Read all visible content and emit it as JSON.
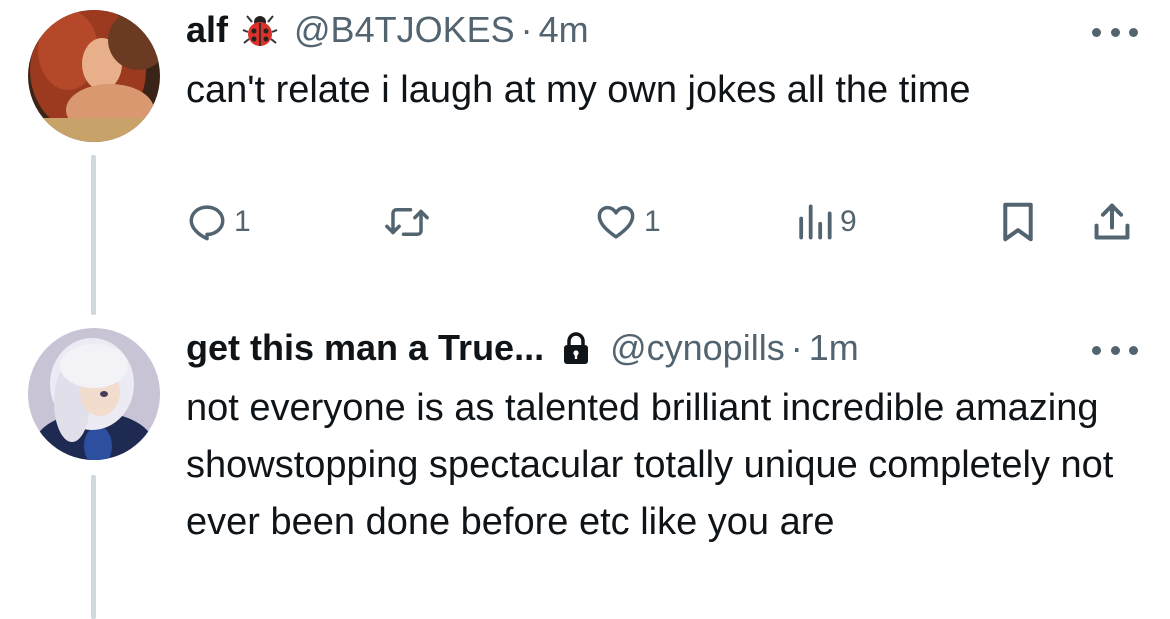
{
  "tweets": [
    {
      "display_name": "alf",
      "badge_icon": "ladybug-icon",
      "handle": "@B4TJOKES",
      "separator": "·",
      "time": "4m",
      "text": "can't relate i laugh at my own jokes all the time",
      "actions": {
        "reply_count": "1",
        "retweet_count": "",
        "like_count": "1",
        "view_count": "9"
      }
    },
    {
      "display_name": "get this man a True...",
      "badge_icon": "lock-icon",
      "handle": "@cynopills",
      "separator": "·",
      "time": "1m",
      "text": "not everyone is as talented brilliant incredible amazing showstopping spectacular totally unique completely not ever been done before etc like you are"
    }
  ],
  "colors": {
    "primary_text": "#0f1419",
    "secondary_text": "#536471",
    "thread_line": "#cfd9de"
  }
}
